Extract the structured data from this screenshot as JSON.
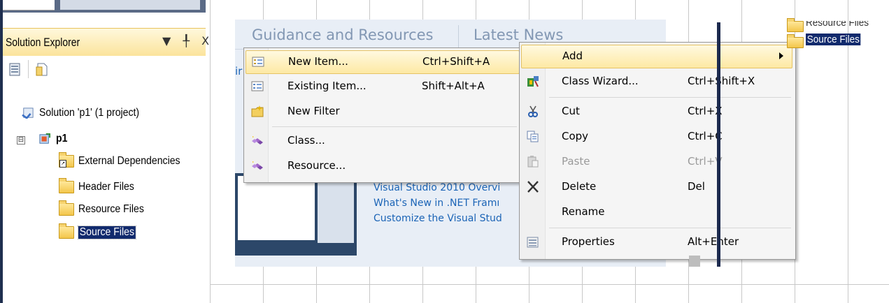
{
  "solution_explorer": {
    "title": "Solution Explorer",
    "controls": "▼ ╀ X",
    "tree": {
      "solution": "Solution 'p1' (1 project)",
      "expander": "⊟",
      "project": "p1",
      "items": [
        {
          "label": "External Dependencies",
          "icon": "dependencies-icon"
        },
        {
          "label": "Header Files",
          "icon": "folder-icon"
        },
        {
          "label": "Resource Files",
          "icon": "folder-icon"
        },
        {
          "label": "Source Files",
          "icon": "folder-icon",
          "selected": true
        }
      ]
    }
  },
  "start_page": {
    "tabs": [
      "Guidance and Resources",
      "Latest News"
    ],
    "partial_link": "ir",
    "links": [
      "Visual Studio 2010 Overvi",
      "What's New in .NET Framı",
      "Customize the Visual Stud"
    ]
  },
  "add_submenu": {
    "items": [
      {
        "label": "New Item...",
        "shortcut": "Ctrl+Shift+A",
        "highlighted": true
      },
      {
        "label": "Existing Item...",
        "shortcut": "Shift+Alt+A"
      },
      {
        "label": "New Filter",
        "shortcut": ""
      },
      {
        "label": "Class...",
        "shortcut": ""
      },
      {
        "label": "Resource...",
        "shortcut": ""
      }
    ]
  },
  "context_menu": {
    "items": [
      {
        "label": "Add",
        "shortcut": "",
        "submenu": true,
        "highlighted": true
      },
      {
        "label": "Class Wizard...",
        "shortcut": "Ctrl+Shift+X"
      },
      {
        "label": "Cut",
        "shortcut": "Ctrl+X"
      },
      {
        "label": "Copy",
        "shortcut": "Ctrl+C"
      },
      {
        "label": "Paste",
        "shortcut": "Ctrl+V",
        "disabled": true
      },
      {
        "label": "Delete",
        "shortcut": "Del"
      },
      {
        "label": "Rename",
        "shortcut": ""
      },
      {
        "label": "Properties",
        "shortcut": "Alt+Enter"
      }
    ]
  },
  "right_tree": {
    "items": [
      "Resource Files",
      "Source Files"
    ]
  },
  "colors": {
    "highlight": "#fde9a4",
    "selection": "#112a6d",
    "link": "#1b64b6",
    "tab_text": "#8297b3"
  }
}
